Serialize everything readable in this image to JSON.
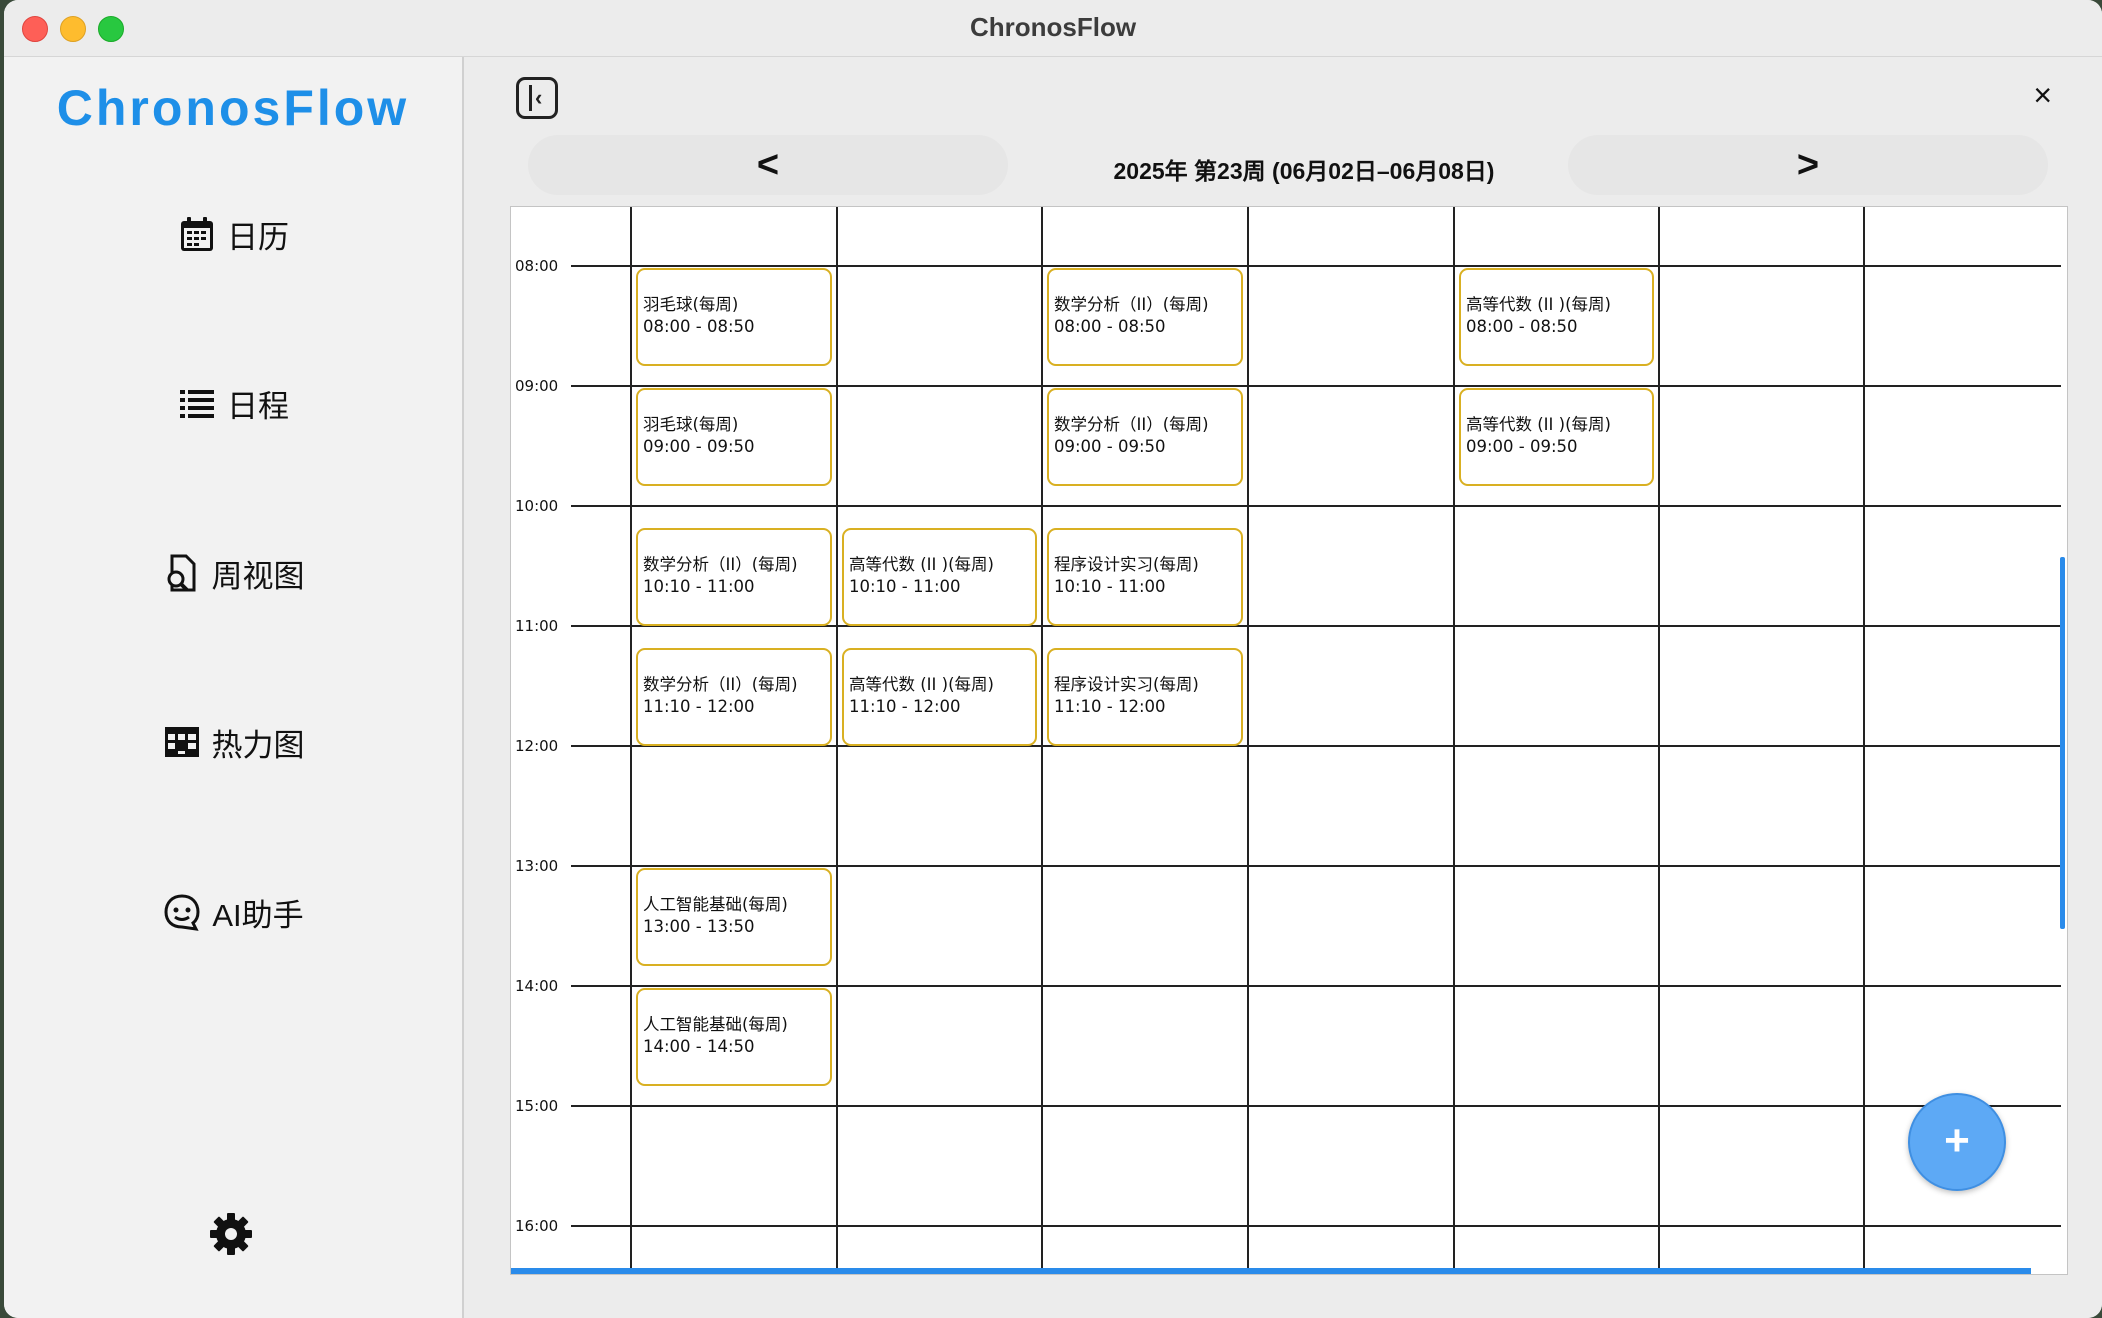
{
  "window": {
    "title": "ChronosFlow"
  },
  "sidebar": {
    "logo": "ChronosFlow",
    "items": [
      {
        "label": "日历",
        "icon": "calendar-icon"
      },
      {
        "label": "日程",
        "icon": "list-icon"
      },
      {
        "label": "周视图",
        "icon": "week-search-icon"
      },
      {
        "label": "热力图",
        "icon": "heatmap-grid-icon"
      },
      {
        "label": "AI助手",
        "icon": "ai-assistant-icon"
      }
    ],
    "settings_icon": "gear-icon"
  },
  "header": {
    "prev_label": "<",
    "next_label": ">",
    "week_label": "2025年 第23周 (06月02日–06月08日)",
    "close_label": "×"
  },
  "calendar": {
    "hours": [
      "08:00",
      "09:00",
      "10:00",
      "11:00",
      "12:00",
      "13:00",
      "14:00",
      "15:00",
      "16:00"
    ],
    "day_count": 7,
    "events": [
      {
        "day": 0,
        "start": "08:00",
        "end": "08:50",
        "title": "羽毛球(每周)",
        "time": "08:00 - 08:50"
      },
      {
        "day": 0,
        "start": "09:00",
        "end": "09:50",
        "title": "羽毛球(每周)",
        "time": "09:00 - 09:50"
      },
      {
        "day": 0,
        "start": "10:10",
        "end": "11:00",
        "title": "数学分析（II）(每周)",
        "time": "10:10 - 11:00"
      },
      {
        "day": 0,
        "start": "11:10",
        "end": "12:00",
        "title": "数学分析（II）(每周)",
        "time": "11:10 - 12:00"
      },
      {
        "day": 0,
        "start": "13:00",
        "end": "13:50",
        "title": "人工智能基础(每周)",
        "time": "13:00 - 13:50"
      },
      {
        "day": 0,
        "start": "14:00",
        "end": "14:50",
        "title": "人工智能基础(每周)",
        "time": "14:00 - 14:50"
      },
      {
        "day": 1,
        "start": "10:10",
        "end": "11:00",
        "title": "高等代数 (II )(每周)",
        "time": "10:10 - 11:00"
      },
      {
        "day": 1,
        "start": "11:10",
        "end": "12:00",
        "title": "高等代数 (II )(每周)",
        "time": "11:10 - 12:00"
      },
      {
        "day": 2,
        "start": "08:00",
        "end": "08:50",
        "title": "数学分析（II）(每周)",
        "time": "08:00 - 08:50"
      },
      {
        "day": 2,
        "start": "09:00",
        "end": "09:50",
        "title": "数学分析（II）(每周)",
        "time": "09:00 - 09:50"
      },
      {
        "day": 2,
        "start": "10:10",
        "end": "11:00",
        "title": "程序设计实习(每周)",
        "time": "10:10 - 11:00"
      },
      {
        "day": 2,
        "start": "11:10",
        "end": "12:00",
        "title": "程序设计实习(每周)",
        "time": "11:10 - 12:00"
      },
      {
        "day": 4,
        "start": "08:00",
        "end": "08:50",
        "title": "高等代数 (II )(每周)",
        "time": "08:00 - 08:50"
      },
      {
        "day": 4,
        "start": "09:00",
        "end": "09:50",
        "title": "高等代数 (II )(每周)",
        "time": "09:00 - 09:50"
      }
    ],
    "colors": {
      "event_border": "#d9b022",
      "accent": "#2a8bea",
      "fab": "#5da9f5"
    }
  },
  "fab": {
    "label": "+"
  }
}
